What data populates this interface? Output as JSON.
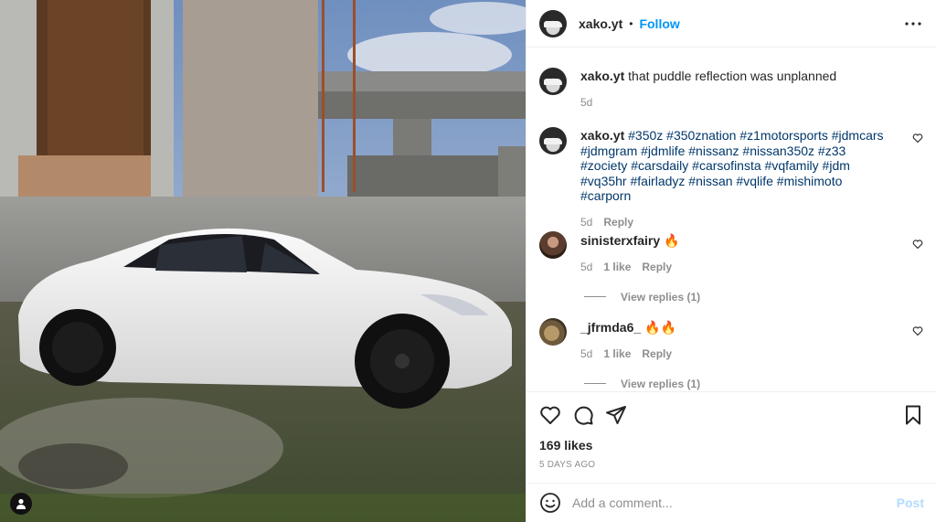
{
  "post": {
    "username": "xako.yt",
    "separator": "•",
    "follow_label": "Follow",
    "more_icon": "more-horizontal-icon"
  },
  "caption": {
    "username": "xako.yt",
    "text": "that puddle reflection was unplanned",
    "time": "5d"
  },
  "comments": [
    {
      "username": "xako.yt",
      "text": "#350z #350znation #z1motorsports #jdmcars #jdmgram #jdmlife #nissanz #nissan350z #z33 #zociety #carsdaily #carsofinsta #vqfamily #jdm #vq35hr #fairladyz #nissan #vqlife #mishimoto #carporn",
      "time": "5d",
      "reply_label": "Reply"
    },
    {
      "username": "sinisterxfairy",
      "text": "🔥",
      "time": "5d",
      "likes": "1 like",
      "reply_label": "Reply",
      "view_replies": "View replies (1)"
    },
    {
      "username": "_jfrmda6_",
      "text": "🔥🔥",
      "time": "5d",
      "likes": "1 like",
      "reply_label": "Reply",
      "view_replies": "View replies (1)"
    }
  ],
  "stats": {
    "likes": "169 likes",
    "posted_ago": "5 DAYS AGO"
  },
  "composer": {
    "placeholder": "Add a comment...",
    "post_label": "Post"
  },
  "colors": {
    "link": "#0095f6",
    "hashtag": "#00376b",
    "muted": "#8e8e8e",
    "post_disabled": "#b3dbff"
  }
}
